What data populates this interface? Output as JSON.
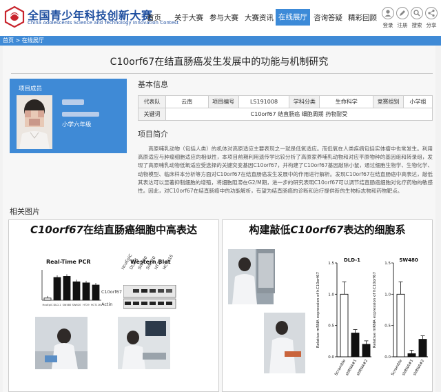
{
  "header": {
    "logo_cn": "全国青少年科技创新大赛",
    "logo_en": "China Adolescents Science and Technology Innovation Contest",
    "nav": [
      "首页",
      "关于大赛",
      "参与大赛",
      "大赛资讯",
      "在线展厅",
      "咨询答疑",
      "精彩回顾"
    ],
    "tools": [
      "登录",
      "注册",
      "搜索",
      "分享"
    ],
    "accent": "#3c8ad8",
    "brand": "#1f4fa0"
  },
  "breadcrumb": "首页 > 在线展厅",
  "page_title": "C10orf67在结直肠癌发生发展中的功能与机制研究",
  "member": {
    "label": "项目成员",
    "grade": "小学六年级"
  },
  "basic_info": {
    "heading": "基本信息",
    "row1": [
      {
        "k": "代表队",
        "v": "云南"
      },
      {
        "k": "项目编号",
        "v": "LS191008"
      },
      {
        "k": "学科分类",
        "v": "生命科学"
      },
      {
        "k": "竞赛组别",
        "v": "小学组"
      }
    ],
    "keywords_label": "关键词",
    "keywords": "C10orf67 结直肠癌 细胞周期 药物耐受"
  },
  "intro": {
    "heading": "项目简介",
    "text": "高原哺乳动物（包括人类）的机体对高原适应主要表现之一就是低氧适应。而低氧在人类疾病包括实体瘤中也常发生。利用高原适应与肿瘤细胞适应的相似性，本项目前期利用遗传学比较分析了高原家养哺乳动物和对应平原物种的基因组和转录组，发现了高原哺乳动物低氧适应受选择的关键突变基因C10orf67，并构建了C10orf67基因敲除小鼠，通过细胞生物学、生物化学、动物模型、临床样本分析等方面对C10orf67在结直肠癌发生发展中的作用进行解析。发现C10orf67在结直肠癌中高表达，敲低其表达可以显著抑制细胞的增殖，将细胞阻滞在G2/M期，进一步的研究表明C10orf67可以调节结直肠癌细胞对化疗药物的敏感性。因此，对C10orf67在结直肠癌中的功能解析，有望为结直肠癌的诊断和治疗提供新的生物标志物和药物靶点。"
  },
  "related": {
    "heading": "相关图片",
    "left": {
      "title_italic": "C10orf67",
      "title_rest": "在结直肠癌细胞中高表达",
      "pcr_label": "Real-Time PCR",
      "wb_label": "Western Blot",
      "wb_lanes": [
        "HcoEpiC",
        "DLD-1",
        "SW480",
        "SW620",
        "HT29",
        "HCT116"
      ],
      "wb_rows": [
        "C10orf67",
        "Actin"
      ]
    },
    "right": {
      "title_pre": "构建敲低",
      "title_italic": "C10orf67",
      "title_rest": "表达的细胞系"
    }
  },
  "chart_data": [
    {
      "type": "bar",
      "title": "Real-Time PCR",
      "categories": [
        "HcoEpiC",
        "DLD-1",
        "SW480",
        "SW620",
        "HT29",
        "HCT116"
      ],
      "values": [
        1.0,
        10.5,
        11.0,
        8.5,
        8.0,
        7.0
      ],
      "ylim": [
        0,
        14
      ]
    },
    {
      "type": "bar",
      "title": "DLD-1",
      "categories": [
        "Scramble",
        "shRNA#1",
        "shRNA#2"
      ],
      "values": [
        1.0,
        0.38,
        0.2
      ],
      "ylabel": "Relative mRNA expression of hC10orf67",
      "ylim": [
        0,
        1.5
      ],
      "yticks": [
        "0.0",
        "0.5",
        "1.0",
        "1.5"
      ]
    },
    {
      "type": "bar",
      "title": "SW480",
      "categories": [
        "Scramble",
        "shRNA#1",
        "shRNA#2"
      ],
      "values": [
        1.0,
        0.05,
        0.28
      ],
      "ylabel": "Relative mRNA expression of hC10orf67",
      "ylim": [
        0,
        1.5
      ],
      "yticks": [
        "0.0",
        "0.5",
        "1.0",
        "1.5"
      ]
    }
  ]
}
